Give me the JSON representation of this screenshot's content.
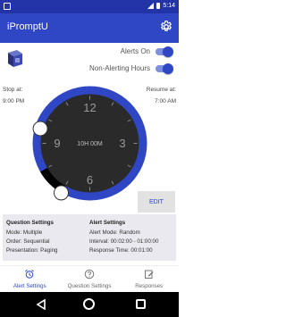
{
  "status_bar": {
    "time": "5:14"
  },
  "app": {
    "title": "iPromptU"
  },
  "toggles": {
    "alerts_on": {
      "label": "Alerts On",
      "state": "on"
    },
    "non_alerting_hours": {
      "label": "Non-Alerting Hours",
      "state": "on"
    }
  },
  "schedule": {
    "stop_label": "Stop at:",
    "stop_time": "9:00 PM",
    "resume_label": "Resume at:",
    "resume_time": "7:00 AM"
  },
  "clock": {
    "numbers": [
      "12",
      "3",
      "6",
      "9"
    ],
    "center_text": "10H 00M"
  },
  "edit_button": {
    "label": "EDIT"
  },
  "question_settings": {
    "heading": "Question Settings",
    "mode": "Mode: Multiple",
    "order": "Order: Sequential",
    "presentation": "Presentation: Paging"
  },
  "alert_settings": {
    "heading": "Alert Settings",
    "mode": "Alert Mode: Random",
    "interval": "Interval: 00:02:00 - 01:00:00",
    "response_time": "Response Time: 00:01:00"
  },
  "bottom_nav": {
    "items": [
      {
        "label": "Alert Settings",
        "icon": "alarm-clock-icon",
        "active": true
      },
      {
        "label": "Question Settings",
        "icon": "question-icon",
        "active": false
      },
      {
        "label": "Responses",
        "icon": "edit-note-icon",
        "active": false
      }
    ]
  },
  "colors": {
    "primary": "#2f47c4",
    "status_bar": "#2234a8",
    "clock_face": "#2a2a2a"
  }
}
